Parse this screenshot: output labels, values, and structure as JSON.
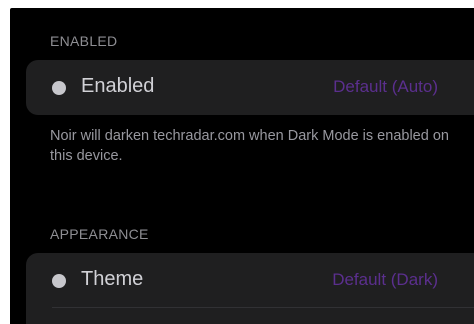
{
  "sections": [
    {
      "header": "ENABLED",
      "row": {
        "label": "Enabled",
        "value": "Default (Auto)",
        "icon": "status-dot-icon"
      },
      "footer": "Noir will darken techradar.com when Dark Mode is enabled on this device."
    },
    {
      "header": "APPEARANCE",
      "row": {
        "label": "Theme",
        "value": "Default (Dark)",
        "icon": "status-dot-icon"
      }
    }
  ],
  "colors": {
    "background": "#000000",
    "card": "#1f1f20",
    "header_text": "#8e8e93",
    "label_text": "#d1d1d6",
    "accent_value": "#5b2f8e",
    "dot": "#c7c7cc"
  }
}
